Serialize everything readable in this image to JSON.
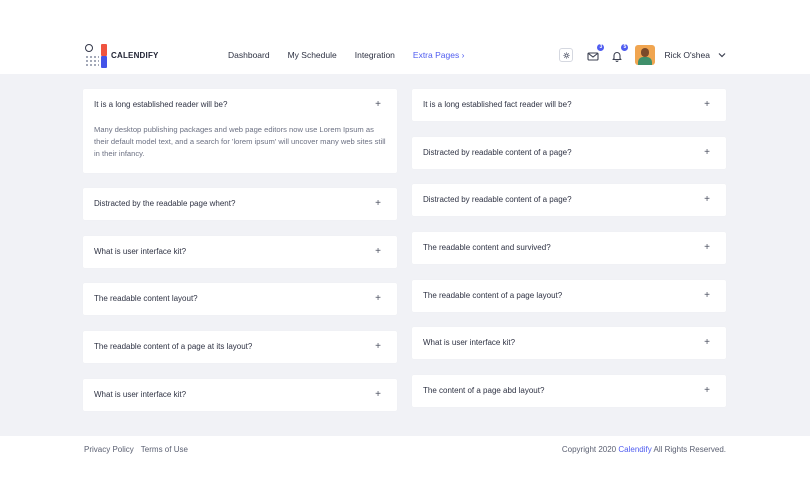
{
  "brand": {
    "name": "CALENDIFY"
  },
  "nav": {
    "items": [
      {
        "label": "Dashboard"
      },
      {
        "label": "My Schedule"
      },
      {
        "label": "Integration"
      },
      {
        "label": "Extra Pages ›"
      }
    ]
  },
  "header": {
    "mail_badge": "3",
    "bell_badge": "5",
    "user_name": "Rick O'shea"
  },
  "faq_left": [
    {
      "question": "It is a long established reader will be?",
      "answer": "Many desktop publishing packages and web page editors now use Lorem Ipsum as their default model text, and a search for 'lorem ipsum' will uncover many web sites still in their infancy.",
      "toggle": "+"
    },
    {
      "question": "Distracted by the readable page whent?",
      "toggle": "+"
    },
    {
      "question": "What is user interface kit?",
      "toggle": "+"
    },
    {
      "question": "The readable content layout?",
      "toggle": "+"
    },
    {
      "question": "The readable content of a page at its layout?",
      "toggle": "+"
    },
    {
      "question": "What is user interface kit?",
      "toggle": "+"
    }
  ],
  "faq_right": [
    {
      "question": "It is a long established fact reader will be?",
      "toggle": "+"
    },
    {
      "question": "Distracted by readable content of a page?",
      "toggle": "+"
    },
    {
      "question": "Distracted by readable content of a page?",
      "toggle": "+"
    },
    {
      "question": "The readable content and survived?",
      "toggle": "+"
    },
    {
      "question": "The readable content of a page layout?",
      "toggle": "+"
    },
    {
      "question": "What is user interface kit?",
      "toggle": "+"
    },
    {
      "question": "The content of a page abd layout?",
      "toggle": "+"
    }
  ],
  "footer": {
    "links": [
      "Privacy Policy",
      "Terms of Use"
    ],
    "copyright_prefix": "Copyright 2020",
    "copyright_brand": "Calendify",
    "copyright_suffix": "All Rights Reserved."
  },
  "icons": {
    "settings": "gear-icon",
    "mail": "mail-icon",
    "bell": "bell-icon",
    "chevron": "chevron-down-icon"
  },
  "colors": {
    "accent": "#4f5cf0",
    "logo_red": "#ef5340",
    "logo_blue": "#4454e8",
    "background": "#f1f2f6"
  }
}
